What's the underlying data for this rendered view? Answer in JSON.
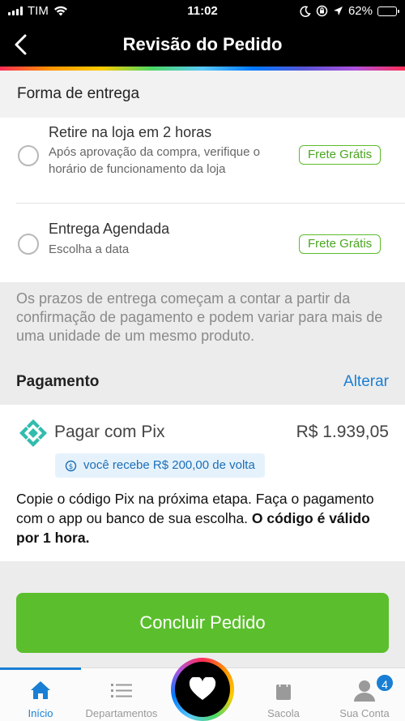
{
  "status_bar": {
    "carrier": "TIM",
    "time": "11:02",
    "battery_percent": "62%",
    "battery_level": 0.62,
    "icons": [
      "signal-icon",
      "wifi-icon",
      "moon-icon",
      "rotation-lock-icon",
      "location-icon",
      "battery-icon"
    ]
  },
  "header": {
    "title": "Revisão do Pedido",
    "back_icon": "chevron-left-icon"
  },
  "delivery": {
    "section_title": "Forma de entrega",
    "options": [
      {
        "title": "Retire na loja em 2 horas",
        "description_line1": "Após aprovação da compra, verifique o",
        "description_line2": "horário de funcionamento da loja",
        "badge": "Frete Grátis",
        "selected": false
      },
      {
        "title": "Entrega Agendada",
        "description_line1": "Escolha a data",
        "badge": "Frete Grátis",
        "selected": false
      }
    ],
    "note": "Os prazos de entrega começam a contar a partir da confirmação de pagamento e podem variar para mais de uma unidade de um mesmo produto."
  },
  "payment": {
    "section_title": "Pagamento",
    "change_label": "Alterar",
    "method_label": "Pagar com Pix",
    "price": "R$ 1.939,05",
    "cashback": "você recebe R$ 200,00 de volta",
    "instructions_normal": "Copie o código Pix na próxima etapa. Faça o pagamento com o app ou banco de sua escolha. ",
    "instructions_bold": "O código é válido por 1 hora."
  },
  "cta": {
    "label": "Concluir Pedido"
  },
  "tabbar": {
    "tabs": [
      {
        "label": "Início",
        "icon": "home-icon",
        "active": true
      },
      {
        "label": "Departamentos",
        "icon": "list-icon",
        "active": false
      },
      {
        "label": "",
        "icon": "heart-icon",
        "active": false
      },
      {
        "label": "Sacola",
        "icon": "bag-icon",
        "active": false
      },
      {
        "label": "Sua Conta",
        "icon": "user-icon",
        "active": false
      }
    ],
    "account_badge": "4"
  },
  "colors": {
    "accent": "#1a7fd4",
    "green": "#5bbf2d",
    "pix": "#32bcad"
  }
}
